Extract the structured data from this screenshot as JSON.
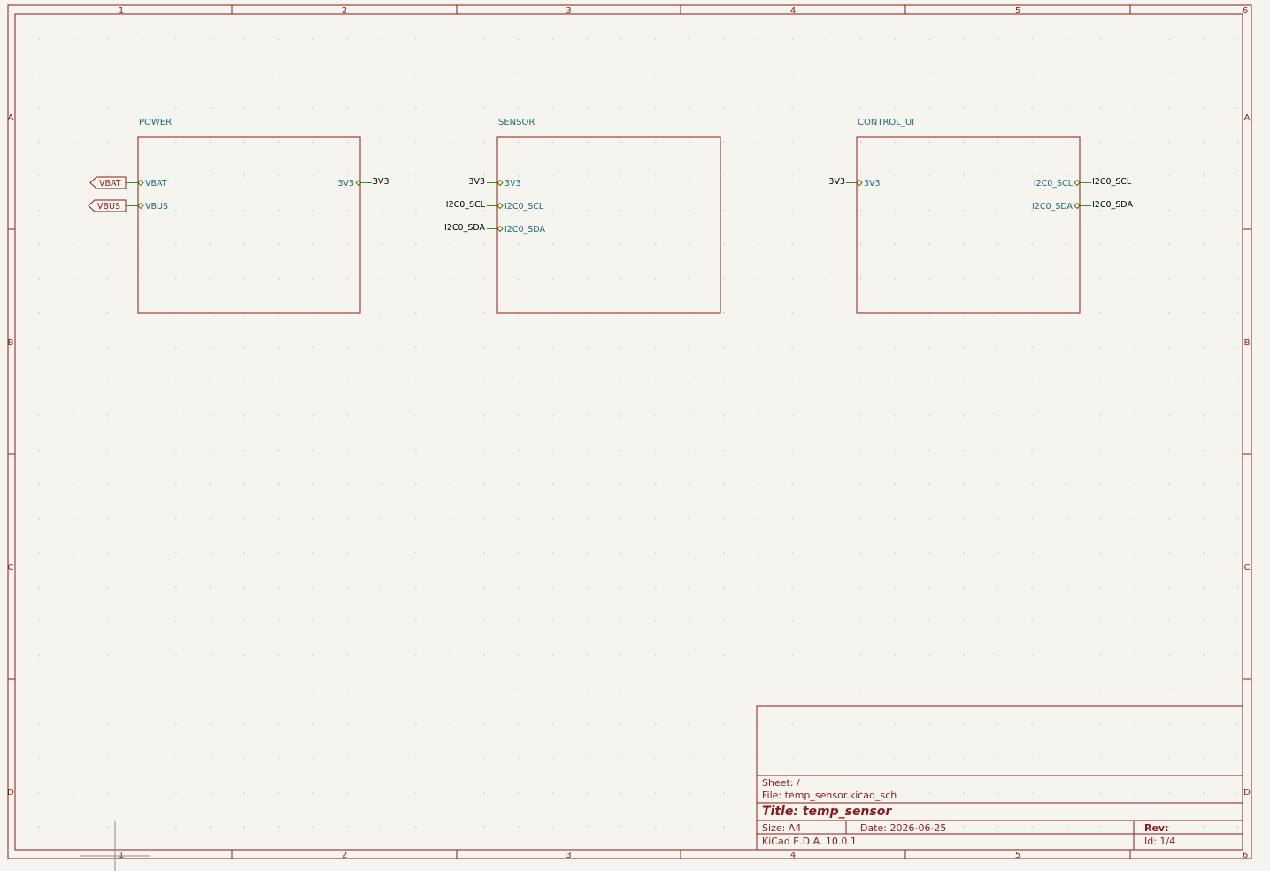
{
  "columns": [
    "1",
    "2",
    "3",
    "4",
    "5",
    "6"
  ],
  "rows": [
    "A",
    "B",
    "C",
    "D"
  ],
  "sheets": [
    {
      "name": "POWER",
      "left_pins": [
        "VBAT",
        "VBUS"
      ],
      "right_pins": [
        "3V3"
      ]
    },
    {
      "name": "SENSOR",
      "left_pins": [
        "3V3",
        "I2C0_SCL",
        "I2C0_SDA"
      ],
      "right_pins": []
    },
    {
      "name": "CONTROL_UI",
      "left_pins": [
        "3V3"
      ],
      "right_pins": [
        "I2C0_SCL",
        "I2C0_SDA"
      ]
    }
  ],
  "hier_labels": [
    "VBAT",
    "VBUS"
  ],
  "net_labels": {
    "power_out": "3V3",
    "sensor_in": [
      "3V3",
      "I2C0_SCL",
      "I2C0_SDA"
    ],
    "control_in": "3V3",
    "control_out": [
      "I2C0_SCL",
      "I2C0_SDA"
    ]
  },
  "title_block": {
    "sheet": "Sheet: /",
    "file": "File: temp_sensor.kicad_sch",
    "title": "Title: temp_sensor",
    "size": "Size: A4",
    "date": "Date: 2026-06-25",
    "rev": "Rev:",
    "app": "KiCad E.D.A. 10.0.1",
    "id": "Id: 1/4"
  },
  "colors": {
    "frame": "#8b1a1a",
    "sheet_text": "#1a6b73",
    "wire": "#2e8b2e",
    "background": "#f5f4ef"
  }
}
